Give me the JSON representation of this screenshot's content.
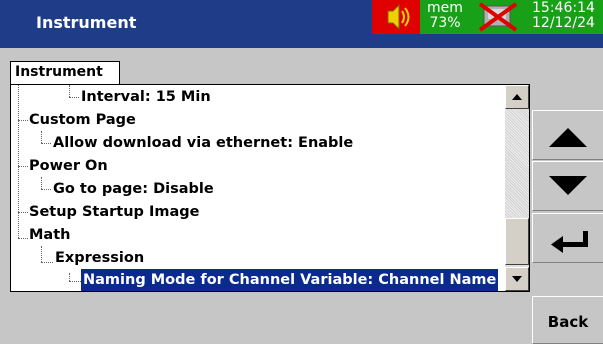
{
  "header": {
    "title": "Instrument",
    "mem_label": "mem",
    "mem_value": "73%",
    "time": "15:46:14",
    "date": "12/12/24",
    "icons": [
      "speaker-icon",
      "no-media-icon"
    ]
  },
  "tab": {
    "label": "Instrument"
  },
  "tree": {
    "items": [
      {
        "label": "Interval: 15 Min"
      },
      {
        "label": "Custom Page"
      },
      {
        "label": "Allow download via ethernet: Enable"
      },
      {
        "label": "Power On"
      },
      {
        "label": "Go to page: Disable"
      },
      {
        "label": "Setup Startup Image"
      },
      {
        "label": "Math"
      },
      {
        "label": "Expression"
      },
      {
        "label": "Naming Mode for Channel Variable: Channel Name"
      }
    ]
  },
  "buttons": {
    "back_label": "Back"
  },
  "colors": {
    "title_bar": "#1f3c88",
    "status_red": "#e00000",
    "status_green": "#18a018",
    "selection": "#0a2a8e"
  }
}
